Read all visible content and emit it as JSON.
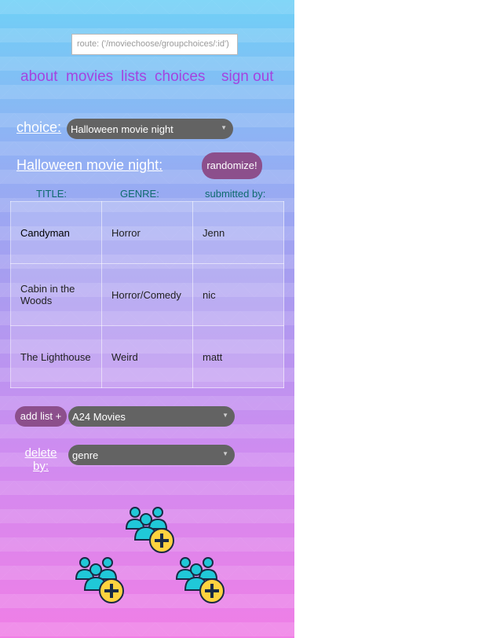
{
  "route": {
    "text": "route: ('/moviechoose/groupchoices/:id')"
  },
  "nav": {
    "about": "about",
    "movies": "movies",
    "lists": "lists",
    "choices": "choices",
    "signout": "sign out"
  },
  "choice": {
    "label": "choice:",
    "selected": "Halloween movie night"
  },
  "list_title": "Halloween movie night:",
  "randomize_label": "randomize!",
  "table": {
    "headers": [
      "TITLE:",
      "GENRE:",
      "submitted by:"
    ],
    "rows": [
      [
        "Candyman",
        "Horror",
        "Jenn"
      ],
      [
        "Cabin in the Woods",
        "Horror/Comedy",
        "nic"
      ],
      [
        "The Lighthouse",
        "Weird",
        "matt"
      ]
    ]
  },
  "add_list": {
    "label": "add list +",
    "selected": "A24 Movies"
  },
  "delete_by": {
    "label_line1": "delete",
    "label_line2": "by:",
    "selected": "genre"
  },
  "colors": {
    "nav": "#a444e0",
    "header_text": "#0f6b6e",
    "pill": "#8c4f8c",
    "select": "#636363"
  },
  "icons": [
    "add-group-icon",
    "add-group-icon",
    "add-group-icon"
  ]
}
